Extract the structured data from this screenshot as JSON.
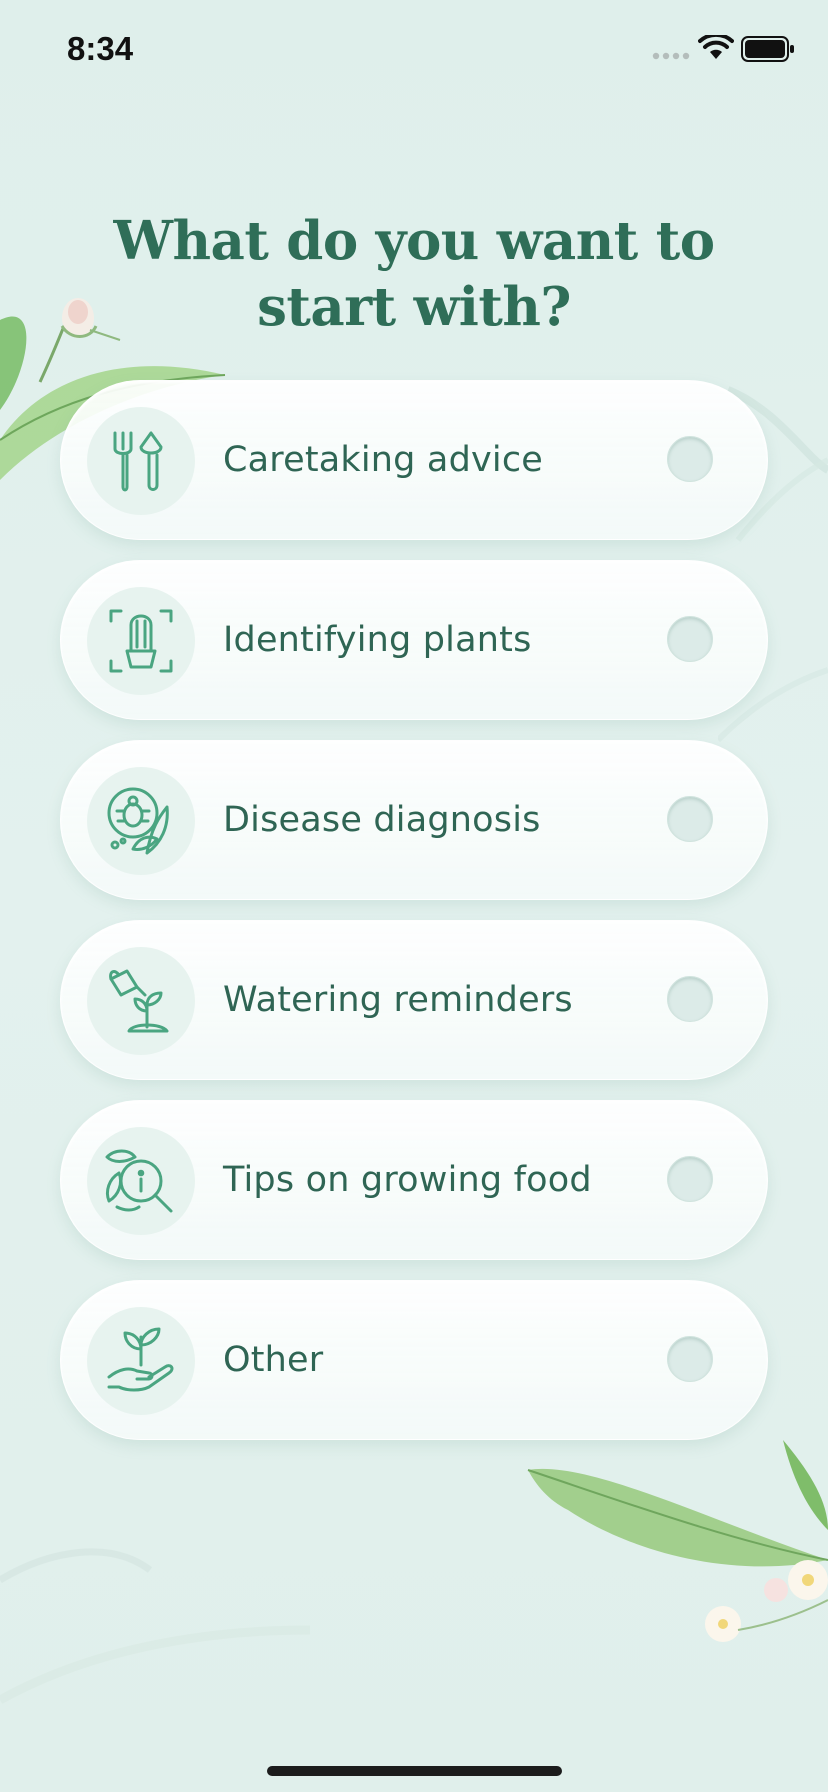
{
  "status_bar": {
    "time": "8:34",
    "icons": [
      "cellular-signal-icon",
      "wifi-icon",
      "battery-icon"
    ]
  },
  "title": "What do you want to start with?",
  "options": [
    {
      "label": "Caretaking advice",
      "icon": "garden-tools-icon",
      "selected": false
    },
    {
      "label": "Identifying plants",
      "icon": "cactus-scan-icon",
      "selected": false
    },
    {
      "label": "Disease diagnosis",
      "icon": "bug-leaf-icon",
      "selected": false
    },
    {
      "label": "Watering reminders",
      "icon": "watering-can-sprout-icon",
      "selected": false
    },
    {
      "label": "Tips on growing food",
      "icon": "leaf-info-magnifier-icon",
      "selected": false
    },
    {
      "label": "Other",
      "icon": "hand-plant-icon",
      "selected": false
    }
  ],
  "colors": {
    "background": "#e0efeb",
    "title": "#2f6e58",
    "label": "#2f6554",
    "icon_stroke": "#4aa581"
  }
}
